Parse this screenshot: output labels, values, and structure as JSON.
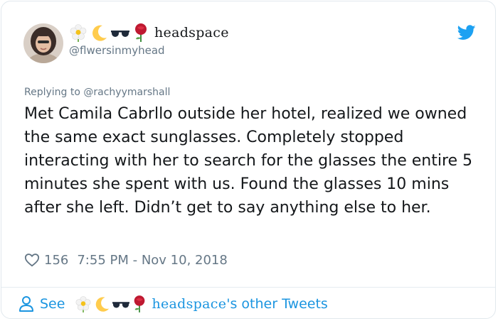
{
  "author": {
    "display_name": "headspace",
    "handle": "@flwersinmyhead",
    "emoji_icons": [
      "blossom-icon",
      "crescent-moon-icon",
      "sunglasses-icon",
      "rose-icon"
    ]
  },
  "reply": {
    "prefix": "Replying to ",
    "mention": "@rachyymarshall"
  },
  "tweet": {
    "text": "Met Camila Cabrllo outside her hotel, realized we owned the same exact sunglasses. Completely stopped interacting with her to search for the glasses the entire 5 minutes she spent with us. Found the glasses 10 mins after she left. Didn’t get to say anything else to her.",
    "likes": "156",
    "timestamp": "7:55 PM - Nov 10, 2018"
  },
  "footer": {
    "see_label": "See",
    "name": "headspace",
    "suffix": "'s other Tweets"
  },
  "colors": {
    "link": "#1b95e0",
    "muted": "#657786",
    "text": "#14171a",
    "twitter_blue": "#1da1f2"
  }
}
